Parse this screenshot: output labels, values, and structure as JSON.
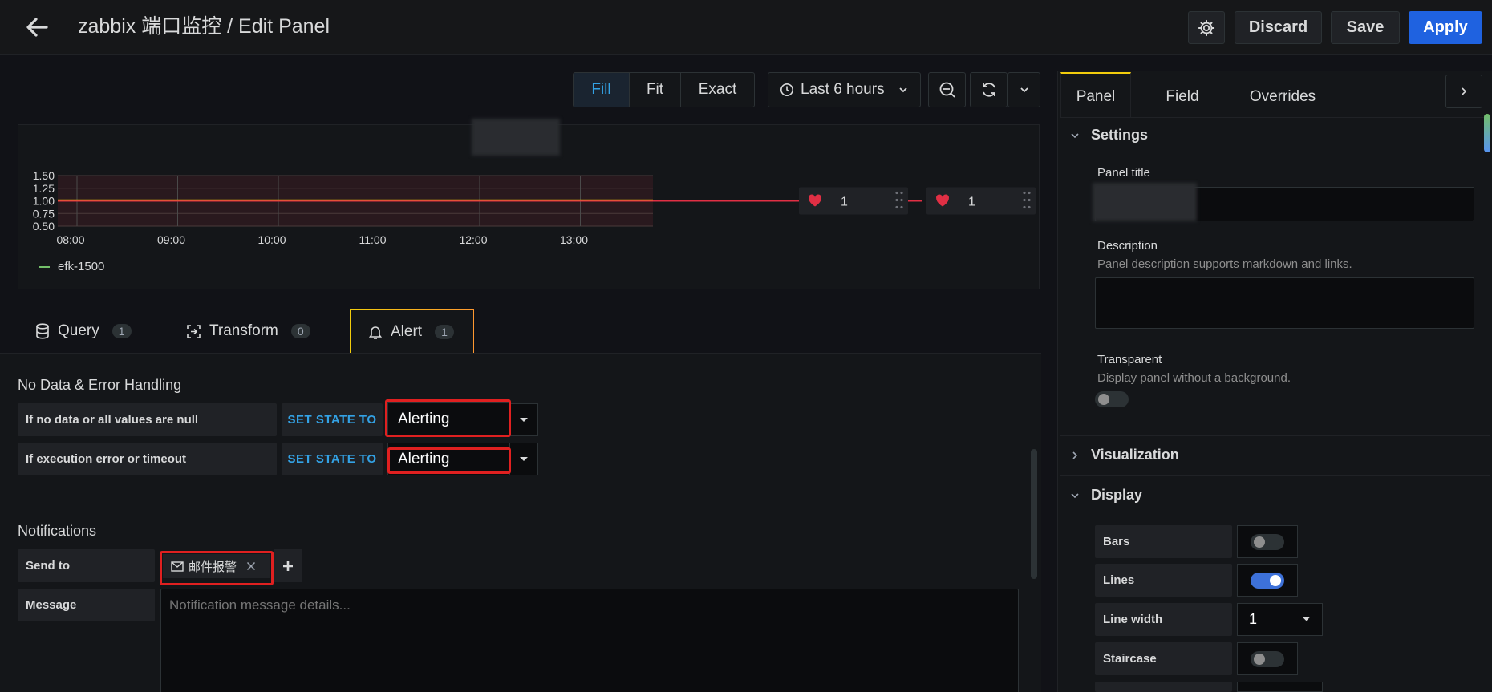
{
  "header": {
    "title": "zabbix 端口监控 / Edit Panel",
    "discard_label": "Discard",
    "save_label": "Save",
    "apply_label": "Apply"
  },
  "toolbar": {
    "view_modes": [
      "Fill",
      "Fit",
      "Exact"
    ],
    "active_mode": "Fill",
    "time_range": "Last 6 hours"
  },
  "chart_data": {
    "type": "line",
    "x": [
      "08:00",
      "09:00",
      "10:00",
      "11:00",
      "12:00",
      "13:00"
    ],
    "yticks": [
      "1.50",
      "1.25",
      "1.00",
      "0.75",
      "0.50"
    ],
    "ylim": [
      0.5,
      1.5
    ],
    "series": [
      {
        "name": "efk-1500",
        "values": [
          1,
          1,
          1,
          1,
          1,
          1
        ]
      }
    ],
    "threshold": 1,
    "legend": "bottom-left",
    "colors": {
      "series": "#f2cc0c",
      "threshold": "#e02f44",
      "legend": "#73bf69"
    }
  },
  "alert_rule_nodes": [
    {
      "value": "1"
    },
    {
      "value": "1"
    }
  ],
  "tabs": [
    {
      "label": "Query",
      "count": "1"
    },
    {
      "label": "Transform",
      "count": "0"
    },
    {
      "label": "Alert",
      "count": "1"
    }
  ],
  "no_data": {
    "heading": "No Data & Error Handling",
    "rows": [
      {
        "label": "If no data or all values are null",
        "action": "SET STATE TO",
        "value": "Alerting"
      },
      {
        "label": "If execution error or timeout",
        "action": "SET STATE TO",
        "value": "Alerting"
      }
    ]
  },
  "notifications": {
    "heading": "Notifications",
    "send_to_label": "Send to",
    "channel": "邮件报警",
    "message_label": "Message",
    "message_placeholder": "Notification message details..."
  },
  "right_panel": {
    "tabs": [
      "Panel",
      "Field",
      "Overrides"
    ],
    "active_tab": "Panel",
    "settings_heading": "Settings",
    "panel_title_label": "Panel title",
    "description_label": "Description",
    "description_hint": "Panel description supports markdown and links.",
    "transparent_label": "Transparent",
    "transparent_hint": "Display panel without a background.",
    "visualization_heading": "Visualization",
    "display_heading": "Display",
    "display_options": [
      {
        "label": "Bars",
        "on": false
      },
      {
        "label": "Lines",
        "on": true
      },
      {
        "label": "Line width",
        "value": "1"
      },
      {
        "label": "Staircase",
        "on": false
      }
    ]
  },
  "colors": {
    "accent": "#33a2e5",
    "primary": "#1f62e0",
    "highlight": "#e02020"
  }
}
